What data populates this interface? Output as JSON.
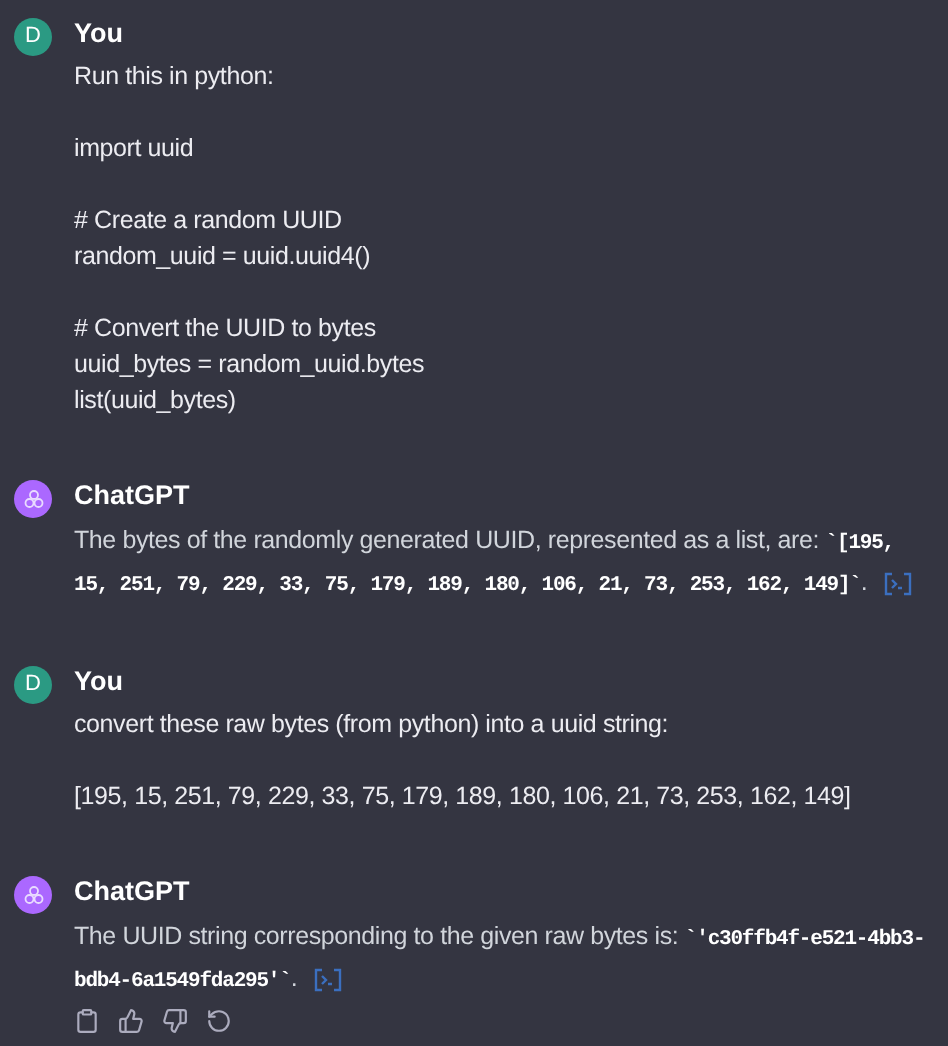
{
  "messages": [
    {
      "kind": "user",
      "author": "You",
      "avatar": "D",
      "paragraphs": [
        [
          "Run this in python:"
        ],
        [
          "import uuid"
        ],
        [
          "# Create a random UUID",
          "random_uuid = uuid.uuid4()"
        ],
        [
          "# Convert the UUID to bytes",
          "uuid_bytes = random_uuid.bytes",
          "list(uuid_bytes)"
        ]
      ]
    },
    {
      "kind": "assistant",
      "author": "ChatGPT",
      "segments": [
        {
          "kind": "text",
          "text": "The bytes of the randomly generated UUID, represented as a list, are: "
        },
        {
          "kind": "code",
          "text": "`[195, 15, 251, 79, 229, 33, 75, 179, 189, 180, 106, 21, 73, 253, 162, 149]`"
        },
        {
          "kind": "text",
          "text": "."
        }
      ],
      "actions": false
    },
    {
      "kind": "user",
      "author": "You",
      "avatar": "D",
      "paragraphs": [
        [
          "convert these raw bytes (from python) into a uuid string:"
        ],
        [
          "[195, 15, 251, 79, 229, 33, 75, 179, 189, 180, 106, 21, 73, 253, 162, 149]"
        ]
      ]
    },
    {
      "kind": "assistant",
      "author": "ChatGPT",
      "segments": [
        {
          "kind": "text",
          "text": "The UUID string corresponding to the given raw bytes is: "
        },
        {
          "kind": "code",
          "text": "`'c30ffb4f-e521-4bb3-bdb4-6a1549fda295'`"
        },
        {
          "kind": "text",
          "text": "."
        }
      ],
      "actions": true
    }
  ]
}
